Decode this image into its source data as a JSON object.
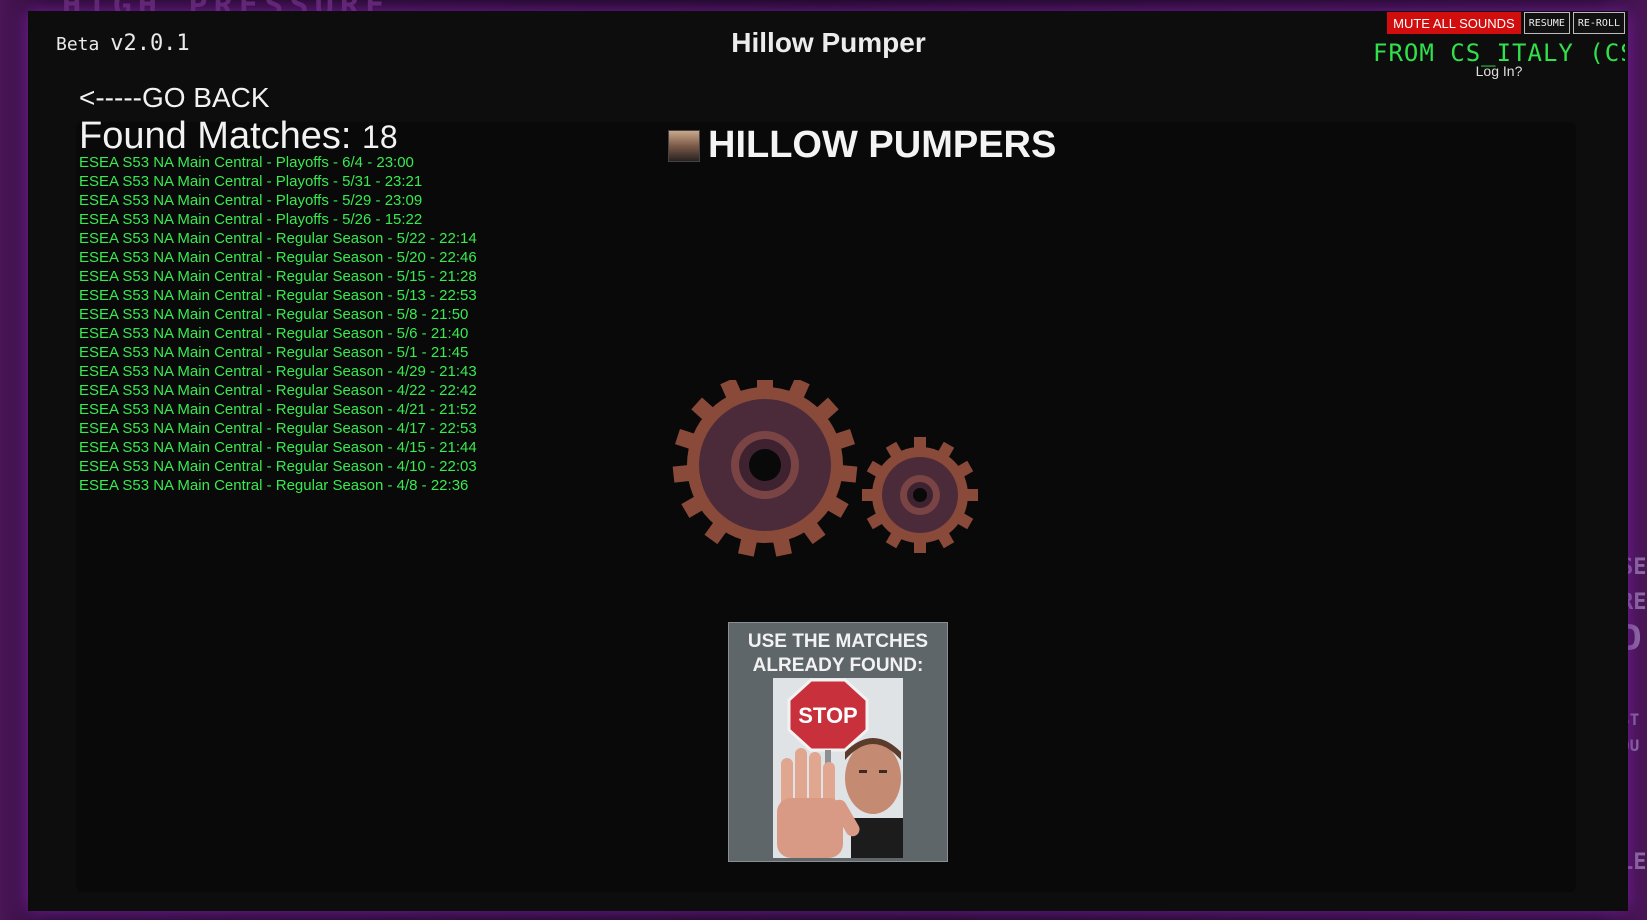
{
  "background": {
    "top_text": "HIGH PRESSURE",
    "right_fragments": [
      "SE",
      "REC",
      "D",
      "ST",
      "OU",
      "LE"
    ]
  },
  "header": {
    "beta_label": "Beta",
    "version": "v2.0.1",
    "title": "Hillow Pumper"
  },
  "controls": {
    "mute_label": "MUTE ALL SOUNDS",
    "resume_label": "RESUME",
    "reroll_label": "RE-ROLL",
    "from_text": "FROM CS_ITALY (CSS",
    "login_label": "Log In?"
  },
  "nav": {
    "go_back": "<-----GO BACK"
  },
  "matches": {
    "heading": "Found Matches:",
    "count": "18",
    "items": [
      "ESEA S53 NA Main Central - Playoffs - 6/4 - 23:00",
      "ESEA S53 NA Main Central - Playoffs - 5/31 - 23:21",
      "ESEA S53 NA Main Central - Playoffs - 5/29 - 23:09",
      "ESEA S53 NA Main Central - Playoffs - 5/26 - 15:22",
      "ESEA S53 NA Main Central - Regular Season - 5/22 - 22:14",
      "ESEA S53 NA Main Central - Regular Season - 5/20 - 22:46",
      "ESEA S53 NA Main Central - Regular Season - 5/15 - 21:28",
      "ESEA S53 NA Main Central - Regular Season - 5/13 - 22:53",
      "ESEA S53 NA Main Central - Regular Season - 5/8 - 21:50",
      "ESEA S53 NA Main Central - Regular Season - 5/6 - 21:40",
      "ESEA S53 NA Main Central - Regular Season - 5/1 - 21:45",
      "ESEA S53 NA Main Central - Regular Season - 4/29 - 21:43",
      "ESEA S53 NA Main Central - Regular Season - 4/22 - 22:42",
      "ESEA S53 NA Main Central - Regular Season - 4/21 - 21:52",
      "ESEA S53 NA Main Central - Regular Season - 4/17 - 22:53",
      "ESEA S53 NA Main Central - Regular Season - 4/15 - 21:44",
      "ESEA S53 NA Main Central - Regular Season - 4/10 - 22:03",
      "ESEA S53 NA Main Central - Regular Season - 4/8 - 22:36"
    ]
  },
  "team": {
    "name": "HILLOW PUMPERS",
    "avatar_icon": "team-avatar-photo"
  },
  "loading": {
    "icon": "gears-icon"
  },
  "stop_card": {
    "caption_line1": "USE THE MATCHES",
    "caption_line2": "ALREADY FOUND:",
    "sign_text": "STOP"
  },
  "colors": {
    "accent_purple": "#7a1fa0",
    "match_green": "#38ea4f",
    "from_green": "#31e14a",
    "mute_red": "#d10d0d",
    "gear_rust": "#8a4a3a"
  }
}
